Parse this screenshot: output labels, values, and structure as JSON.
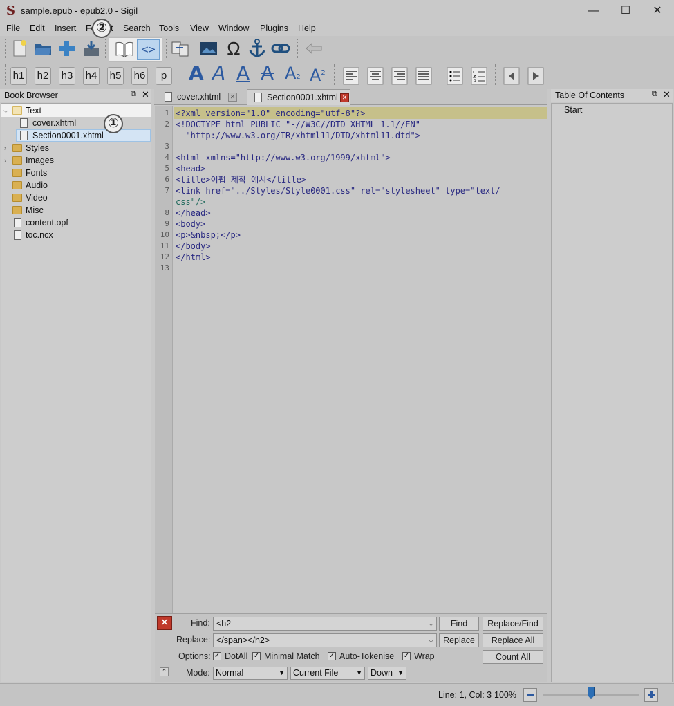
{
  "window": {
    "title": "sample.epub - epub2.0 - Sigil",
    "min": "—",
    "max": "☐",
    "close": "✕"
  },
  "menu": [
    "File",
    "Edit",
    "Insert",
    "Format",
    "Search",
    "Tools",
    "View",
    "Window",
    "Plugins",
    "Help"
  ],
  "heading_buttons": [
    "h1",
    "h2",
    "h3",
    "h4",
    "h5",
    "h6",
    "p"
  ],
  "book_browser": {
    "title": "Book Browser",
    "items": [
      {
        "label": "Text",
        "type": "folder"
      },
      {
        "label": "cover.xhtml",
        "type": "file"
      },
      {
        "label": "Section0001.xhtml",
        "type": "file"
      },
      {
        "label": "Styles",
        "type": "folder"
      },
      {
        "label": "Images",
        "type": "folder"
      },
      {
        "label": "Fonts",
        "type": "folder"
      },
      {
        "label": "Audio",
        "type": "folder"
      },
      {
        "label": "Video",
        "type": "folder"
      },
      {
        "label": "Misc",
        "type": "folder"
      },
      {
        "label": "content.opf",
        "type": "file"
      },
      {
        "label": "toc.ncx",
        "type": "file"
      }
    ]
  },
  "tabs": [
    {
      "label": "cover.xhtml",
      "active": false
    },
    {
      "label": "Section0001.xhtml",
      "active": true
    }
  ],
  "line_numbers": [
    "1",
    "2",
    "",
    "3",
    "4",
    "5",
    "6",
    "7",
    "8",
    "",
    "9",
    "10",
    "11",
    "12",
    "13"
  ],
  "code_lines": [
    "<?xml version=\"1.0\" encoding=\"utf-8\"?>",
    "<!DOCTYPE html PUBLIC \"-//W3C//DTD XHTML 1.1//EN\"",
    "  \"http://www.w3.org/TR/xhtml11/DTD/xhtml11.dtd\">",
    "",
    "<html xmlns=\"http://www.w3.org/1999/xhtml\">",
    "<head>",
    "<title>이펍 제작 예시</title>",
    "<link href=\"../Styles/Style0001.css\" rel=\"stylesheet\" type=\"text/",
    "css\"/>",
    "</head>",
    "<body>",
    "<p>&nbsp;</p>",
    "</body>",
    "</html>"
  ],
  "toc": {
    "title": "Table Of Contents",
    "items": [
      "Start"
    ]
  },
  "find_replace": {
    "find_label": "Find:",
    "find_value": "<h2",
    "replace_label": "Replace:",
    "replace_value": "</span></h2>",
    "options_label": "Options:",
    "options": [
      {
        "label": "DotAll",
        "checked": true
      },
      {
        "label": "Minimal Match",
        "checked": true
      },
      {
        "label": "Auto-Tokenise",
        "checked": true
      },
      {
        "label": "Wrap",
        "checked": true
      }
    ],
    "mode_label": "Mode:",
    "mode": "Normal",
    "scope": "Current File",
    "direction": "Down",
    "buttons": {
      "find": "Find",
      "replace_find": "Replace/Find",
      "replace": "Replace",
      "replace_all": "Replace All",
      "count_all": "Count All"
    }
  },
  "status": {
    "position": "Line: 1, Col: 3",
    "zoom": "100%",
    "zoom_level_fraction": 0.5
  },
  "annotations": [
    "①",
    "②"
  ],
  "colors": {
    "highlight_line": "#c6c08a",
    "selected_row": "#d4e4f4",
    "error_red": "#c0392b"
  }
}
